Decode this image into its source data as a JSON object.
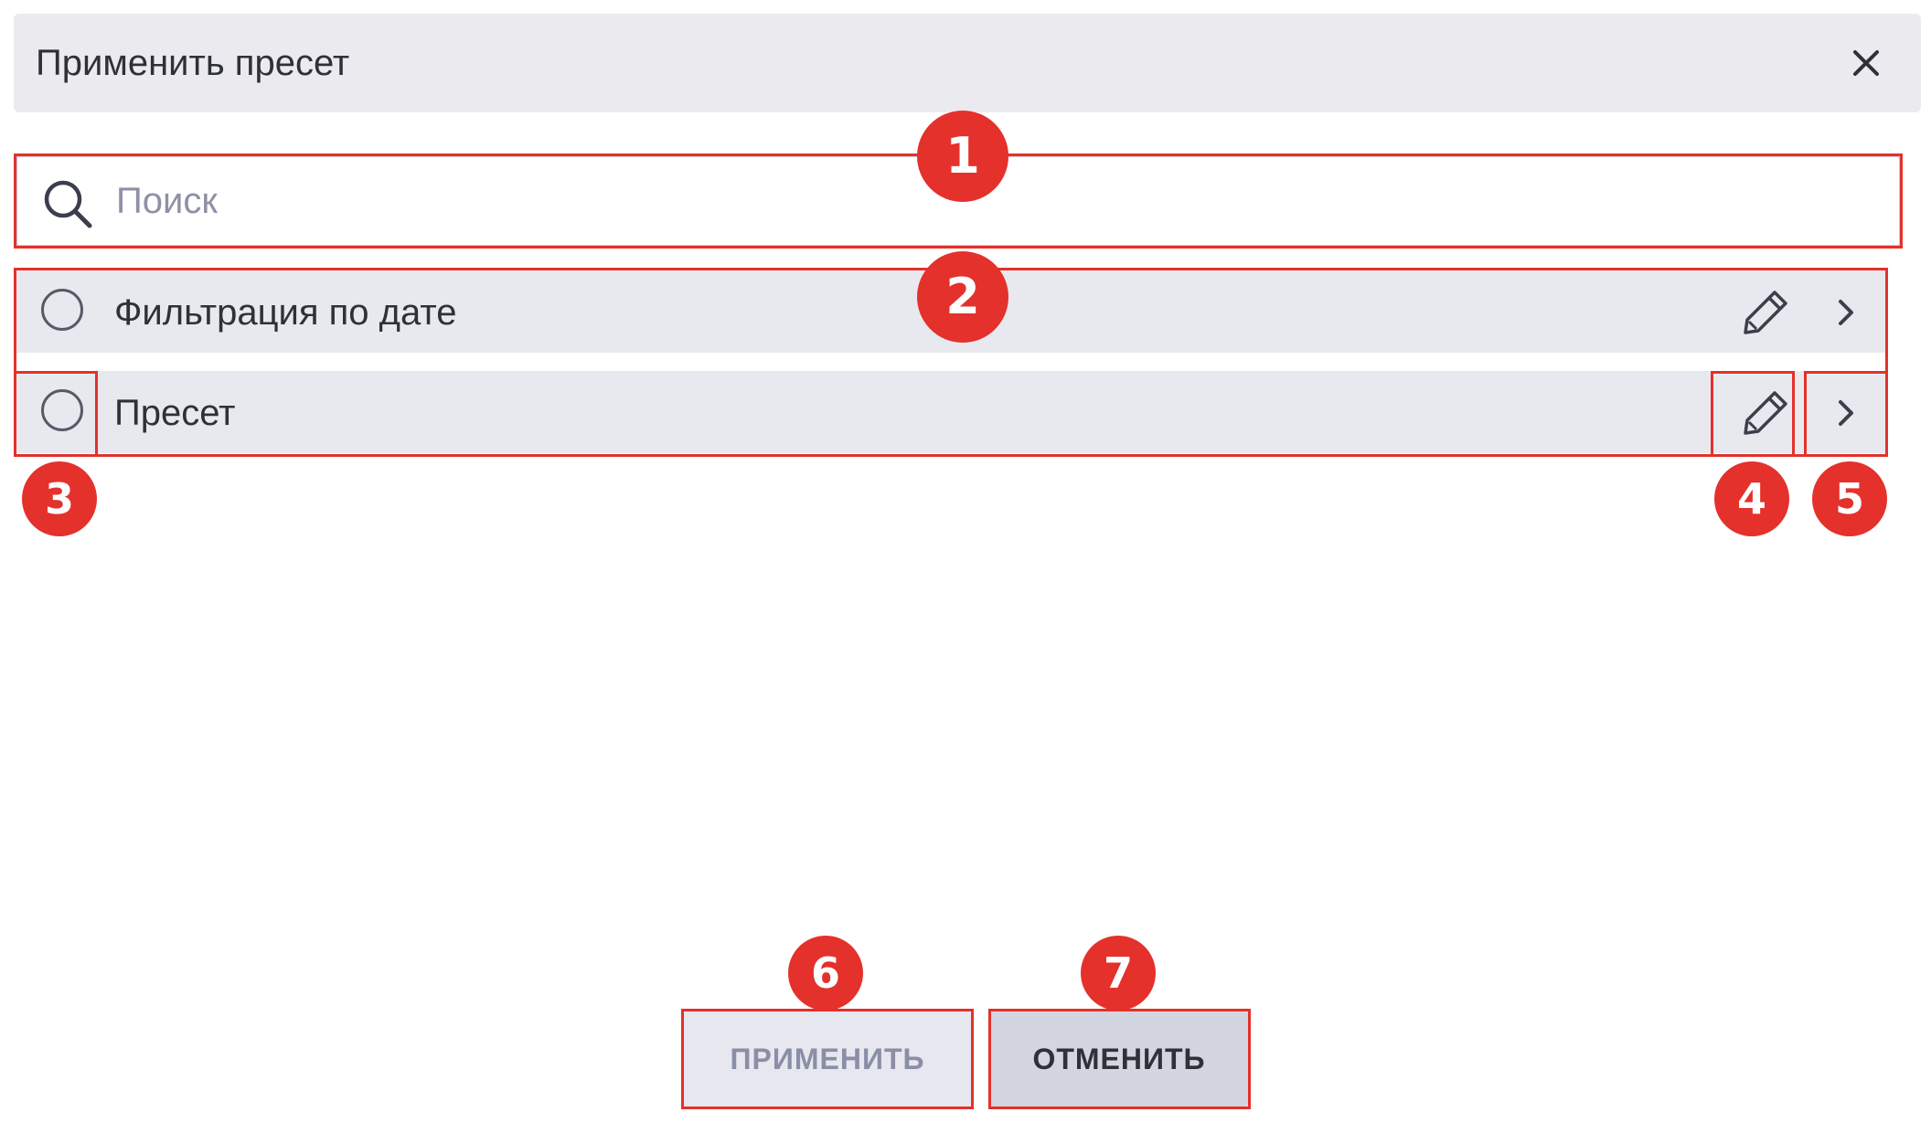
{
  "dialog": {
    "title": "Применить пресет",
    "close_icon": "close-icon"
  },
  "search": {
    "placeholder": "Поиск",
    "value": "",
    "icon": "search-icon"
  },
  "presets": [
    {
      "label": "Фильтрация по дате",
      "selected": false,
      "edit_icon": "pencil-icon",
      "open_icon": "chevron-right-icon"
    },
    {
      "label": "Пресет",
      "selected": false,
      "edit_icon": "pencil-icon",
      "open_icon": "chevron-right-icon"
    }
  ],
  "buttons": {
    "apply": {
      "label": "ПРИМЕНИТЬ",
      "enabled": false
    },
    "cancel": {
      "label": "ОТМЕНИТЬ",
      "enabled": true
    }
  },
  "callouts": [
    "1",
    "2",
    "3",
    "4",
    "5",
    "6",
    "7"
  ],
  "colors": {
    "header_bg": "#ebebef",
    "row_bg": "#e8e9ee",
    "text": "#2f3139",
    "placeholder": "#8e91a6",
    "apply_bg": "#e6e7ef",
    "apply_text": "#8a8ea6",
    "cancel_bg": "#d3d5e0",
    "callout": "#e4312b"
  }
}
